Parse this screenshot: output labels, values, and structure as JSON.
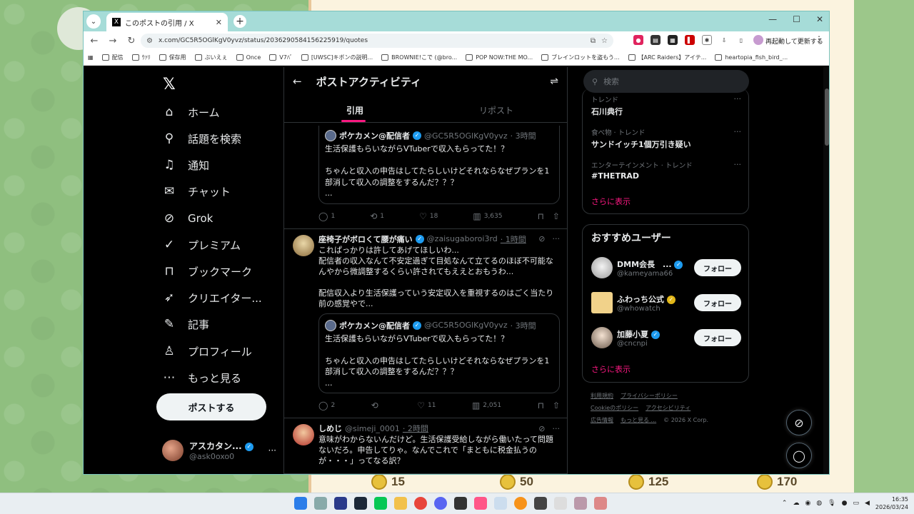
{
  "browser": {
    "tab_title": "このポストの引用 / X",
    "url": "x.com/GC5R5OGlKgV0yvz/status/2036290584156225919/quotes",
    "relaunch_label": "再起動して更新する",
    "bookmarks": [
      "配信",
      "ｳｧﾘ",
      "保存用",
      "ぶいえぇ",
      "Once",
      "V7ﾊﾞ",
      "[UWSC]キボンの説明...",
      "BROWNIE!こで (@bro...",
      "POP NOW:THE MO...",
      "ブレインロットを盗もう...",
      "【ARC Raiders】アイテ...",
      "heartopia_fish_bird_..."
    ]
  },
  "nav": {
    "home": "ホーム",
    "explore": "話題を検索",
    "notifications": "通知",
    "chat": "チャット",
    "grok": "Grok",
    "premium": "プレミアム",
    "bookmarks": "ブックマーク",
    "creator": "クリエイター...",
    "articles": "記事",
    "profile": "プロフィール",
    "more": "もっと見る",
    "post_button": "ポストする",
    "me_name": "アスカタン...",
    "me_handle": "@ask0oxo0"
  },
  "center": {
    "title": "ポストアクティビティ",
    "tabs": [
      "引用",
      "リポスト"
    ]
  },
  "quoted": {
    "name": "ポケカメン@配信者",
    "handle": "@GC5R5OGlKgV0yvz",
    "time": "· 3時間",
    "text": "生活保護もらいながらVTuberで収入もらってた！？\n\nちゃんと収入の申告はしてたらしいけどそれならなぜプランを1部消して収入の調整をするんだ？？？\n..."
  },
  "posts": [
    {
      "actions": {
        "reply": "1",
        "repost": "1",
        "like": "18",
        "views": "3,635"
      }
    },
    {
      "name": "座椅子がボロくて腰が痛い",
      "handle": "@zaisugaboroi3rd",
      "time": "· 1時間",
      "text": "これぱっかりは許してあげてほしいわ...\n配信者の収入なんて不安定過ぎて目処なんて立てるのほぼ不可能なんやから微調整するくらい許されてもええとおもうわ...\n\n配信収入より生活保護っていう安定収入を重視するのはごく当たり前の感覚やで...",
      "actions": {
        "reply": "2",
        "repost": "",
        "like": "11",
        "views": "2,051"
      }
    },
    {
      "name": "しめじ",
      "handle": "@simeji_0001",
      "time": "· 2時間",
      "text": "意味がわからないんだけど。生活保護受給しながら働いたって問題ないだろ。申告してりゃ。なんでこれで「まともに税金払うのが・・・」ってなる訳？"
    }
  ],
  "right": {
    "search_placeholder": "検索",
    "trends": [
      {
        "category": "トレンド",
        "name": "石川典行"
      },
      {
        "category": "食べ物 · トレンド",
        "name": "サンドイッチ1個万引き疑い"
      },
      {
        "category": "エンターテインメント · トレンド",
        "name": "#THETRAD"
      }
    ],
    "show_more": "さらに表示",
    "wtf_title": "おすすめユーザー",
    "users": [
      {
        "name": "DMM会長　...",
        "handle": "@kameyama66",
        "follow": "フォロー"
      },
      {
        "name": "ふわっち公式",
        "handle": "@whowatch",
        "follow": "フォロー"
      },
      {
        "name": "加藤小夏",
        "handle": "@cncnpi",
        "follow": "フォロー"
      }
    ],
    "footer": [
      "利用規約",
      "プライバシーポリシー",
      "Cookieのポリシー",
      "アクセシビリティ",
      "広告情報",
      "もっと見る ...",
      "© 2026 X Corp."
    ]
  },
  "game": {
    "coins": [
      "15",
      "50",
      "125",
      "170"
    ]
  },
  "taskbar": {
    "time": "16:35",
    "date": "2026/03/24"
  }
}
